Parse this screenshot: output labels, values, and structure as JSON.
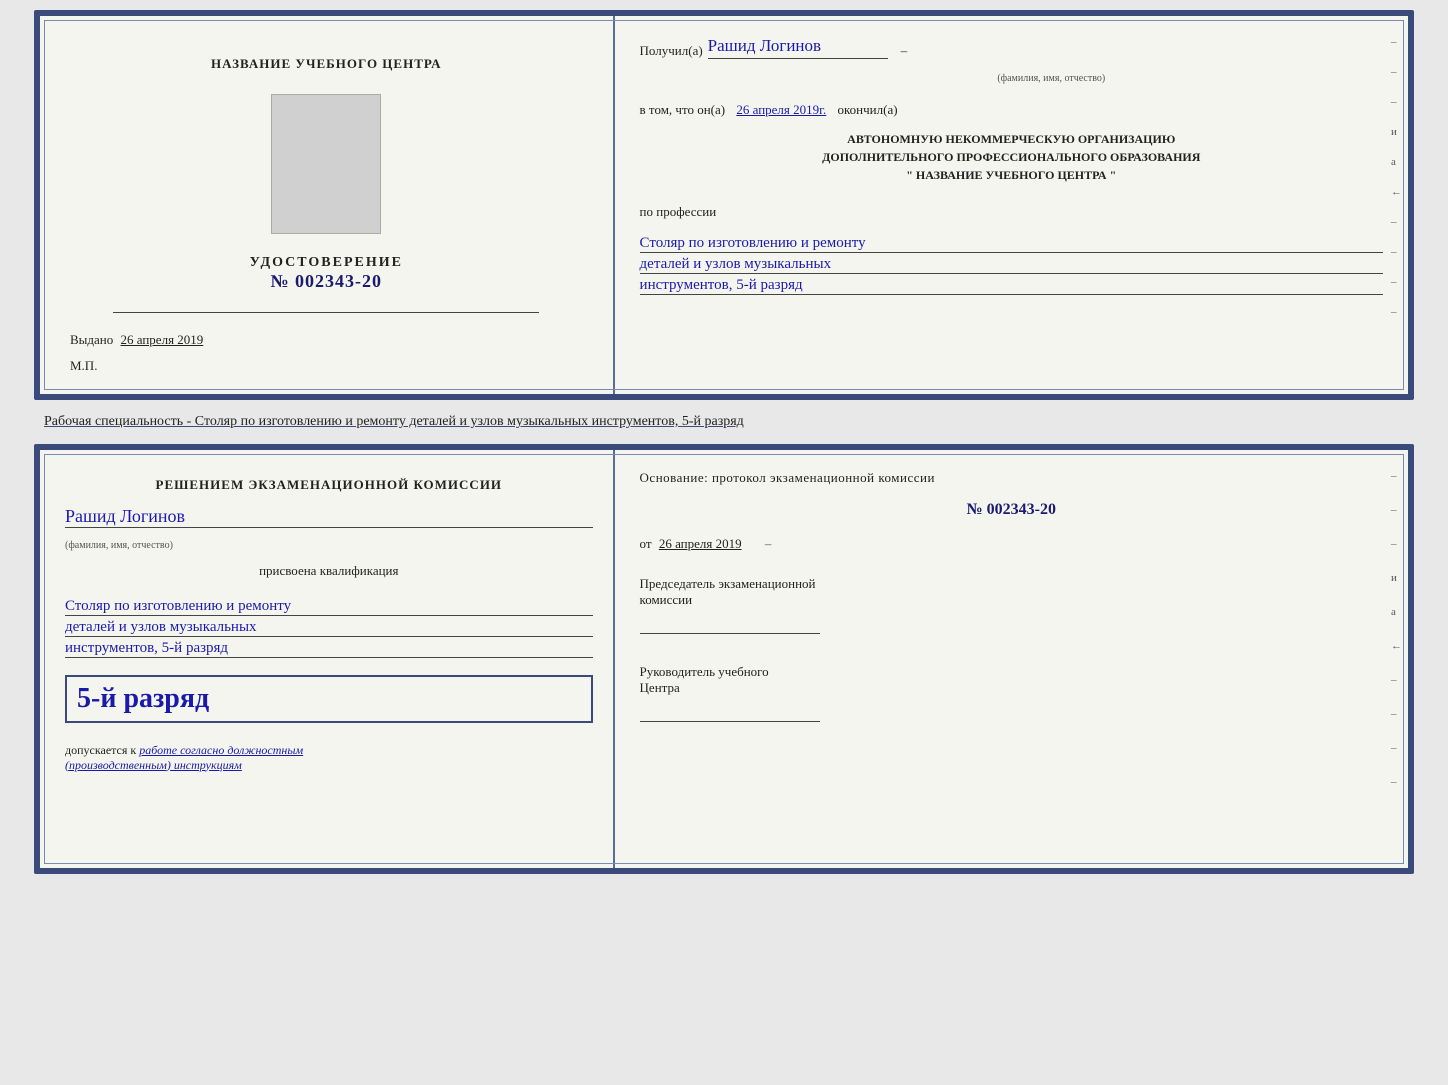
{
  "top_doc": {
    "left": {
      "org_name": "НАЗВАНИЕ УЧЕБНОГО ЦЕНТРА",
      "cert_label": "УДОСТОВЕРЕНИЕ",
      "cert_number": "№ 002343-20",
      "issued_label": "Выдано",
      "issued_date": "26 апреля 2019",
      "mp_label": "М.П."
    },
    "right": {
      "received_label": "Получил(а)",
      "recipient_name": "Рашид Логинов",
      "fio_hint": "(фамилия, имя, отчество)",
      "date_label": "в том, что он(а)",
      "date_value": "26 апреля 2019г.",
      "finished_label": "окончил(а)",
      "org_line1": "АВТОНОМНУЮ НЕКОММЕРЧЕСКУЮ ОРГАНИЗАЦИЮ",
      "org_line2": "ДОПОЛНИТЕЛЬНОГО ПРОФЕССИОНАЛЬНОГО ОБРАЗОВАНИЯ",
      "org_line3": "\"   НАЗВАНИЕ УЧЕБНОГО ЦЕНТРА   \"",
      "profession_label": "по профессии",
      "profession_line1": "Столяр по изготовлению и ремонту",
      "profession_line2": "деталей и узлов музыкальных",
      "profession_line3": "инструментов, 5-й разряд"
    },
    "side_dashes": [
      "-",
      "-",
      "-",
      "и",
      "а",
      "←",
      "-",
      "-",
      "-",
      "-"
    ]
  },
  "specialty_text": "Рабочая специальность - Столяр по изготовлению и ремонту деталей и узлов музыкальных инструментов, 5-й разряд",
  "bottom_doc": {
    "left": {
      "decision_label": "Решением экзаменационной комиссии",
      "person_name": "Рашид Логинов",
      "fio_hint": "(фамилия, имя, отчество)",
      "assigned_label": "присвоена квалификация",
      "qualification_line1": "Столяр по изготовлению и ремонту",
      "qualification_line2": "деталей и узлов музыкальных",
      "qualification_line3": "инструментов, 5-й разряд",
      "highlighted_label": "5-й разряд",
      "allowed_label": "допускается к",
      "allowed_text": "работе согласно должностным",
      "allowed_text2": "(производственным) инструкциям"
    },
    "right": {
      "basis_label": "Основание: протокол экзаменационной комиссии",
      "protocol_number": "№  002343-20",
      "date_prefix": "от",
      "date_value": "26 апреля 2019",
      "chairman_line1": "Председатель экзаменационной",
      "chairman_line2": "комиссии",
      "head_line1": "Руководитель учебного",
      "head_line2": "Центра"
    },
    "side_dashes": [
      "-",
      "-",
      "-",
      "и",
      "а",
      "←",
      "-",
      "-",
      "-",
      "-"
    ]
  }
}
